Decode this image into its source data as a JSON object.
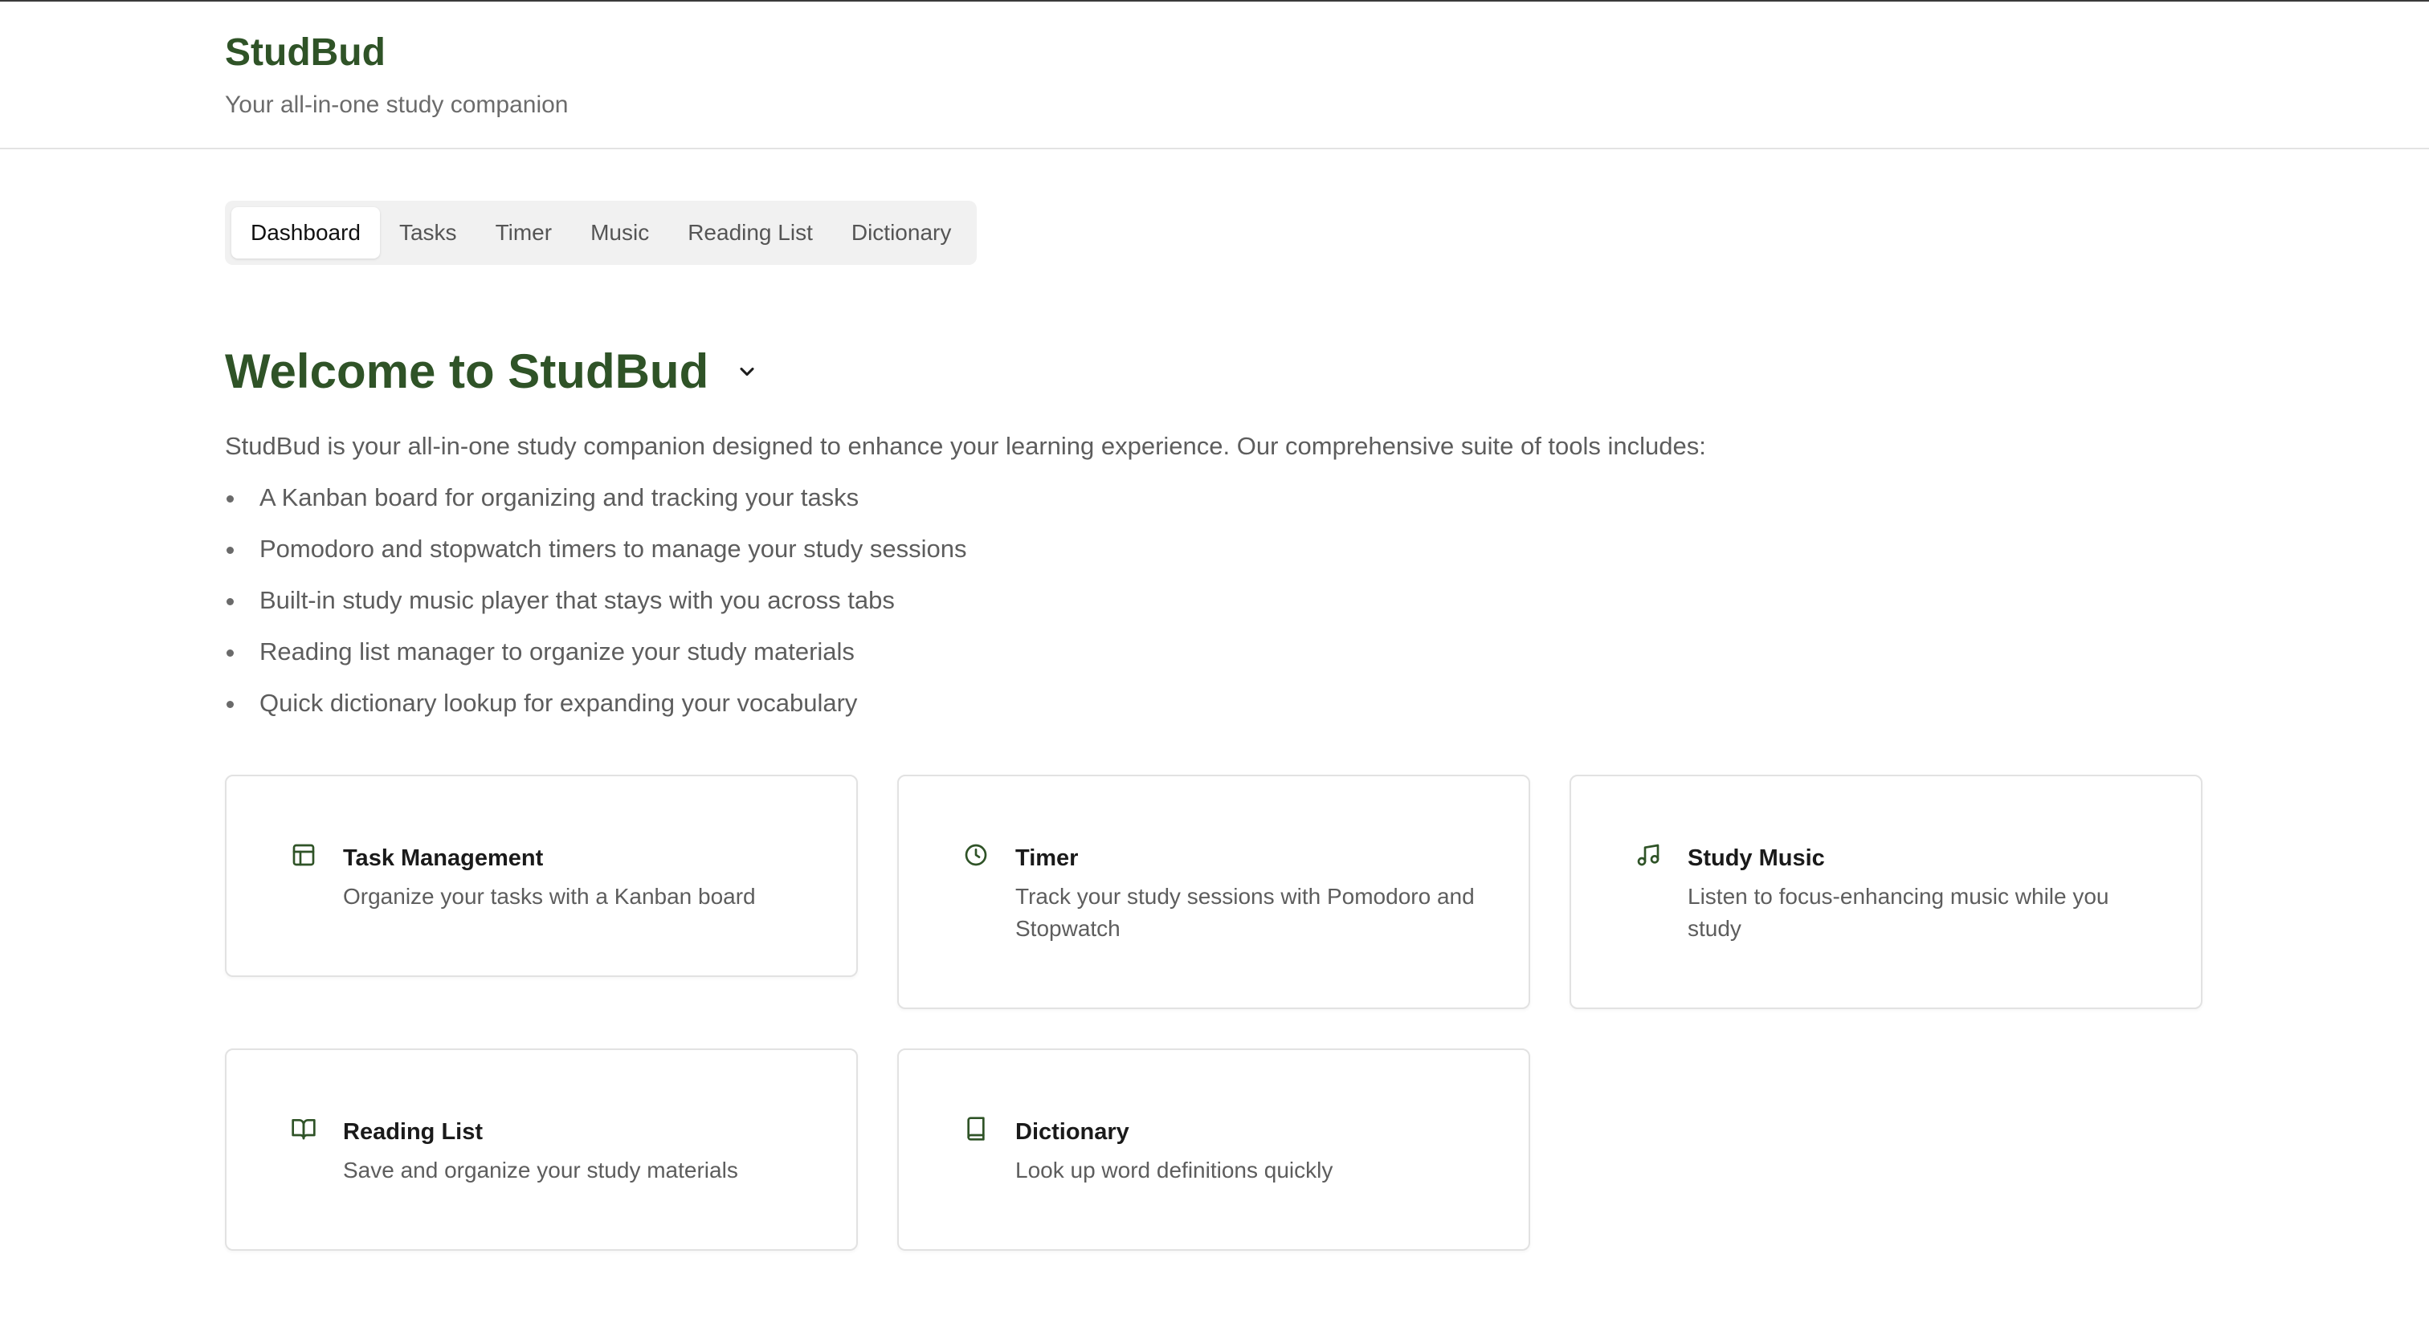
{
  "header": {
    "brand": "StudBud",
    "tagline": "Your all-in-one study companion"
  },
  "tabs": [
    {
      "label": "Dashboard",
      "active": true
    },
    {
      "label": "Tasks",
      "active": false
    },
    {
      "label": "Timer",
      "active": false
    },
    {
      "label": "Music",
      "active": false
    },
    {
      "label": "Reading List",
      "active": false
    },
    {
      "label": "Dictionary",
      "active": false
    }
  ],
  "welcome": {
    "title": "Welcome to StudBud",
    "toggle_icon": "chevron-down-icon",
    "intro": "StudBud is your all-in-one study companion designed to enhance your learning experience. Our comprehensive suite of tools includes:",
    "features": [
      "A Kanban board for organizing and tracking your tasks",
      "Pomodoro and stopwatch timers to manage your study sessions",
      "Built-in study music player that stays with you across tabs",
      "Reading list manager to organize your study materials",
      "Quick dictionary lookup for expanding your vocabulary"
    ]
  },
  "cards": [
    {
      "icon": "kanban-icon",
      "title": "Task Management",
      "description": "Organize your tasks with a Kanban board"
    },
    {
      "icon": "clock-icon",
      "title": "Timer",
      "description": "Track your study sessions with Pomodoro and Stopwatch"
    },
    {
      "icon": "music-note-icon",
      "title": "Study Music",
      "description": "Listen to focus-enhancing music while you study"
    },
    {
      "icon": "open-book-icon",
      "title": "Reading List",
      "description": "Save and organize your study materials"
    },
    {
      "icon": "book-icon",
      "title": "Dictionary",
      "description": "Look up word definitions quickly"
    }
  ],
  "colors": {
    "brand_green": "#2f5327",
    "muted_text": "#5d5d5d",
    "border": "#e2e2e2",
    "tab_bar_bg": "#f1f1f1"
  }
}
